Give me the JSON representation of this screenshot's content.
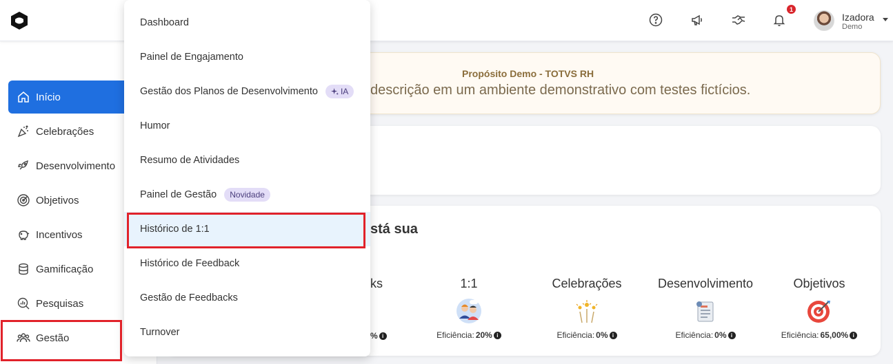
{
  "header": {
    "user_name": "Izadora",
    "user_role": "Demo",
    "notification_count": "1",
    "icons": [
      "help-icon",
      "megaphone-icon",
      "handshake-icon",
      "bell-icon"
    ]
  },
  "sidebar": {
    "items": [
      {
        "label": "Início",
        "icon": "home-icon",
        "active": true
      },
      {
        "label": "Celebrações",
        "icon": "party-icon"
      },
      {
        "label": "Desenvolvimento",
        "icon": "rocket-icon"
      },
      {
        "label": "Objetivos",
        "icon": "target-icon"
      },
      {
        "label": "Incentivos",
        "icon": "piggy-bank-icon"
      },
      {
        "label": "Gamificação",
        "icon": "coins-icon"
      },
      {
        "label": "Pesquisas",
        "icon": "chart-search-icon"
      },
      {
        "label": "Gestão",
        "icon": "people-icon"
      }
    ]
  },
  "dropdown": {
    "items": [
      {
        "label": "Dashboard"
      },
      {
        "label": "Painel de Engajamento"
      },
      {
        "label": "Gestão dos Planos de Desenvolvimento",
        "badge": "IA"
      },
      {
        "label": "Humor"
      },
      {
        "label": "Resumo de Atividades"
      },
      {
        "label": "Painel de Gestão",
        "badge": "Novidade"
      },
      {
        "label": "Histórico de 1:1",
        "selected": true
      },
      {
        "label": "Histórico de Feedback"
      },
      {
        "label": "Gestão de Feedbacks"
      },
      {
        "label": "Turnover"
      }
    ]
  },
  "purpose": {
    "title": "Propósito Demo - TOTVS RH",
    "text": "descrição em um ambiente demonstrativo com testes fictícios."
  },
  "summary": {
    "title_fragment": "stá sua",
    "partial_metric_name": "ks",
    "partial_metric_eff": "%",
    "eff_label": "Eficiência:",
    "metrics": [
      {
        "name": "1:1",
        "value": "20%",
        "icon": "meeting-icon"
      },
      {
        "name": "Celebrações",
        "value": "0%",
        "icon": "fireworks-icon"
      },
      {
        "name": "Desenvolvimento",
        "value": "0%",
        "icon": "development-icon"
      },
      {
        "name": "Objetivos",
        "value": "65,00%",
        "icon": "target-icon"
      }
    ]
  },
  "colors": {
    "primary": "#1f6fe0",
    "highlight_border": "#e1222a",
    "badge_bg": "#e3ddf7",
    "purpose_text": "#7b6a4e"
  }
}
